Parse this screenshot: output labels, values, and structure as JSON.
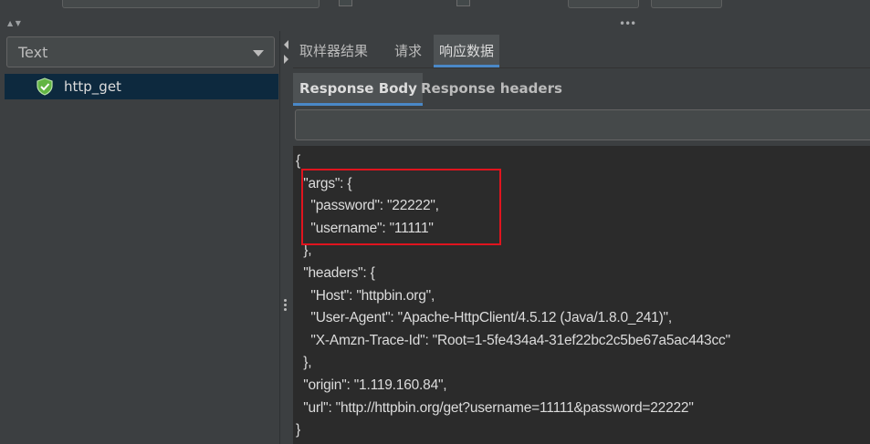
{
  "left_panel": {
    "renderer_select": {
      "selected": "Text"
    },
    "tree": {
      "items": [
        {
          "label": "http_get",
          "status": "success-shield-icon"
        }
      ]
    }
  },
  "result_tabs": [
    {
      "label": "取样器结果",
      "active": false
    },
    {
      "label": "请求",
      "active": false
    },
    {
      "label": "响应数据",
      "active": true
    }
  ],
  "response_tabs": [
    {
      "label": "Response Body",
      "active": true
    },
    {
      "label": "Response headers",
      "active": false
    }
  ],
  "search": {
    "value": ""
  },
  "response_body": [
    "{",
    "  \"args\": {",
    "    \"password\": \"22222\",",
    "    \"username\": \"11111\"",
    "  },",
    "  \"headers\": {",
    "    \"Host\": \"httpbin.org\",",
    "    \"User-Agent\": \"Apache-HttpClient/4.5.12 (Java/1.8.0_241)\",",
    "    \"X-Amzn-Trace-Id\": \"Root=1-5fe434a4-31ef22bc2c5be67a5ac443cc\"",
    "  },",
    "  \"origin\": \"1.119.160.84\",",
    "  \"url\": \"http://httpbin.org/get?username=11111&password=22222\"",
    "}"
  ],
  "colors": {
    "background": "#3c3f41",
    "editor": "#2b2b2b",
    "accent": "#4a88c7",
    "selection": "#0d293e",
    "highlight": "#e0141e",
    "success": "#62b543"
  }
}
